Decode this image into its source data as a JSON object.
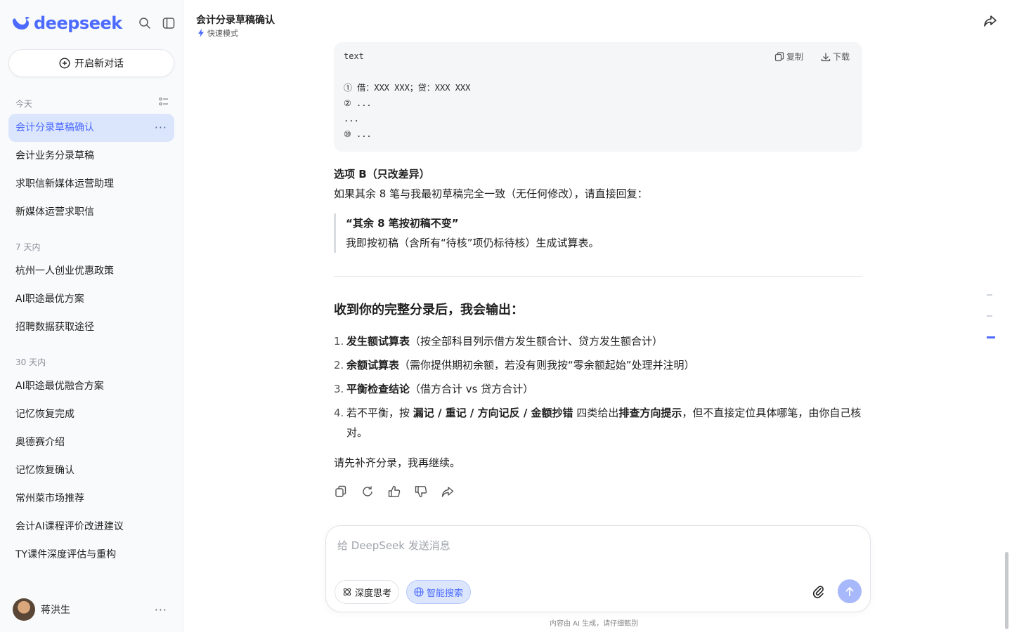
{
  "brand": {
    "name": "deepseek",
    "color": "#4d6bfe"
  },
  "sidebar": {
    "new_chat_label": "开启新对话",
    "groups": [
      {
        "label": "今天",
        "items": [
          "会计分录草稿确认",
          "会计业务分录草稿",
          "求职信新媒体运营助理",
          "新媒体运营求职信"
        ]
      },
      {
        "label": "7 天内",
        "items": [
          "杭州一人创业优惠政策",
          "AI职途最优方案",
          "招聘数据获取途径"
        ]
      },
      {
        "label": "30 天内",
        "items": [
          "AI职途最优融合方案",
          "记忆恢复完成",
          "奥德赛介绍",
          "记忆恢复确认",
          "常州菜市场推荐",
          "会计AI课程评价改进建议",
          "TY课件深度评估与重构"
        ]
      }
    ],
    "active_item": "会计分录草稿确认",
    "user_name": "蒋洪生"
  },
  "header": {
    "title": "会计分录草稿确认",
    "mode": "快速模式"
  },
  "code_block": {
    "lang": "text",
    "copy_label": "复制",
    "download_label": "下载",
    "lines": [
      "① 借：XXX XXX；贷：XXX XXX",
      "② ...",
      "...",
      "⑩ ..."
    ]
  },
  "message": {
    "option_title": "选项 B（只改差异）",
    "option_desc": "如果其余 8 笔与我最初草稿完全一致（无任何修改），请直接回复：",
    "quote_bold": "“其余 8 笔按初稿不变”",
    "quote_text": "我即按初稿（含所有“待核”项仍标待核）生成试算表。",
    "heading": "收到你的完整分录后，我会输出：",
    "list": [
      {
        "num": "1.",
        "bold": "发生额试算表",
        "text": "（按全部科目列示借方发生额合计、贷方发生额合计）"
      },
      {
        "num": "2.",
        "bold": "余额试算表",
        "text": "（需你提供期初余额，若没有则我按“零余额起始”处理并注明）"
      },
      {
        "num": "3.",
        "bold": "平衡检查结论",
        "text": "（借方合计 vs 贷方合计）"
      },
      {
        "num": "4.",
        "pre": "若不平衡，按 ",
        "bold": "漏记 / 重记 / 方向记反 / 金额抄错",
        "mid": " 四类给出",
        "bold2": "排查方向提示",
        "text": "，但不直接定位具体哪笔，由你自己核对。"
      }
    ],
    "closing": "请先补齐分录，我再继续。"
  },
  "composer": {
    "placeholder": "给 DeepSeek 发送消息",
    "deep_think_label": "深度思考",
    "smart_search_label": "智能搜索"
  },
  "disclaimer": "内容由 AI 生成，请仔细甄别"
}
